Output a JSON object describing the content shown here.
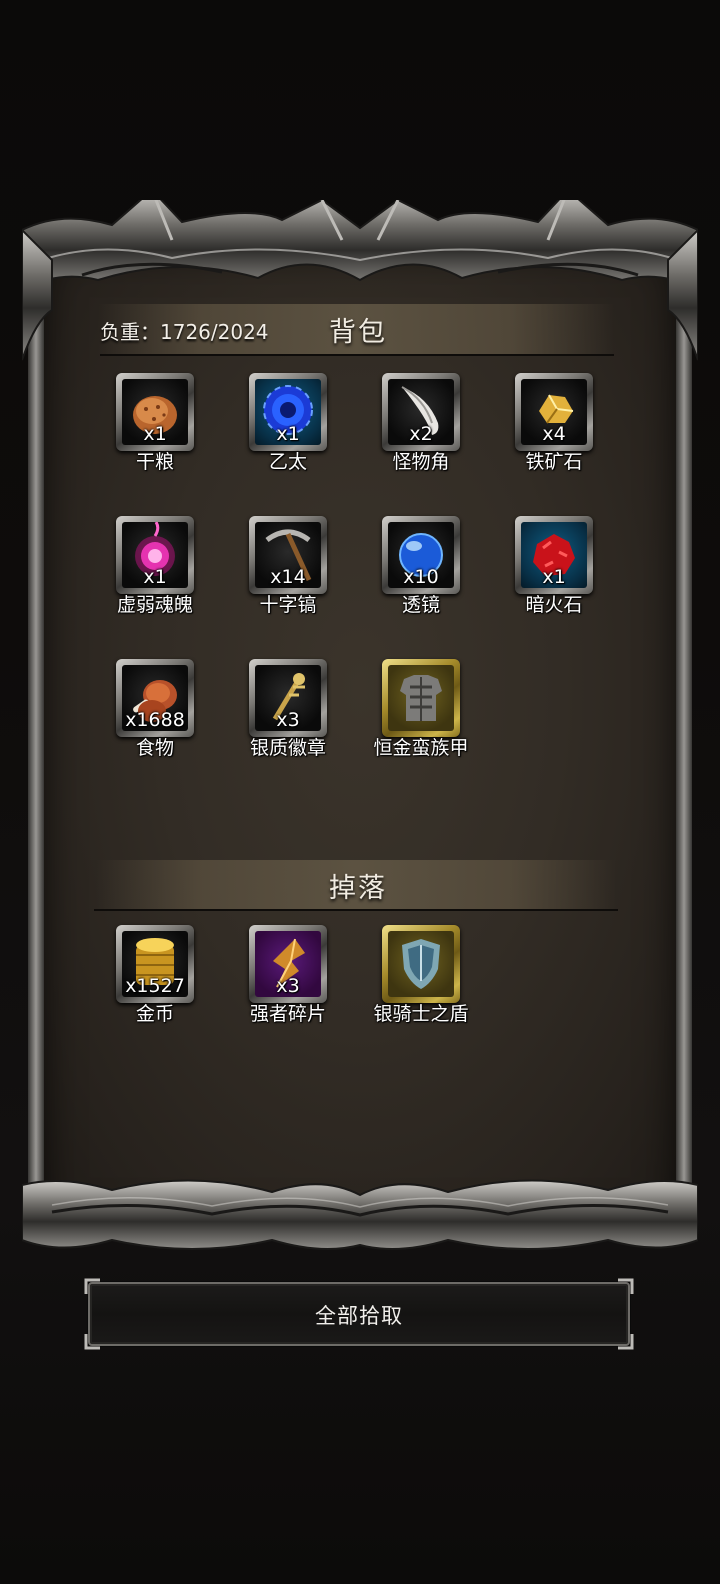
{
  "panel": {
    "backpack_title": "背包",
    "weight_label": "负重：1726/2024",
    "drops_title": "掉落"
  },
  "backpack_items": [
    {
      "name": "干粮",
      "count": "x1",
      "icon": "bread-icon",
      "frame": "silver"
    },
    {
      "name": "乙太",
      "count": "x1",
      "icon": "blue-orb-icon",
      "frame": "blue"
    },
    {
      "name": "怪物角",
      "count": "x2",
      "icon": "horn-icon",
      "frame": "silver"
    },
    {
      "name": "铁矿石",
      "count": "x4",
      "icon": "gold-ore-icon",
      "frame": "silver"
    },
    {
      "name": "虚弱魂魄",
      "count": "x1",
      "icon": "pink-soul-icon",
      "frame": "silver"
    },
    {
      "name": "十字镐",
      "count": "x14",
      "icon": "pickaxe-icon",
      "frame": "silver"
    },
    {
      "name": "透镜",
      "count": "x10",
      "icon": "blue-lens-icon",
      "frame": "silver"
    },
    {
      "name": "暗火石",
      "count": "x1",
      "icon": "red-stone-icon",
      "frame": "blue"
    },
    {
      "name": "食物",
      "count": "x1688",
      "icon": "meat-icon",
      "frame": "silver"
    },
    {
      "name": "银质徽章",
      "count": "x3",
      "icon": "badge-icon",
      "frame": "silver"
    },
    {
      "name": "恒金蛮族甲",
      "count": "",
      "icon": "armor-icon",
      "frame": "gold"
    }
  ],
  "drop_items": [
    {
      "name": "金币",
      "count": "x1527",
      "icon": "gold-coins-icon",
      "frame": "silver"
    },
    {
      "name": "强者碎片",
      "count": "x3",
      "icon": "shard-icon",
      "frame": "purple"
    },
    {
      "name": "银骑士之盾",
      "count": "",
      "icon": "shield-icon",
      "frame": "gold"
    }
  ],
  "actions": {
    "pickup_all": "全部拾取"
  },
  "colors": {
    "panel_bg": "#322c25",
    "text": "#ffffff",
    "frame_silver": "#9a9894",
    "frame_blue": "#0f5d83",
    "frame_gold": "#cdb54a"
  }
}
